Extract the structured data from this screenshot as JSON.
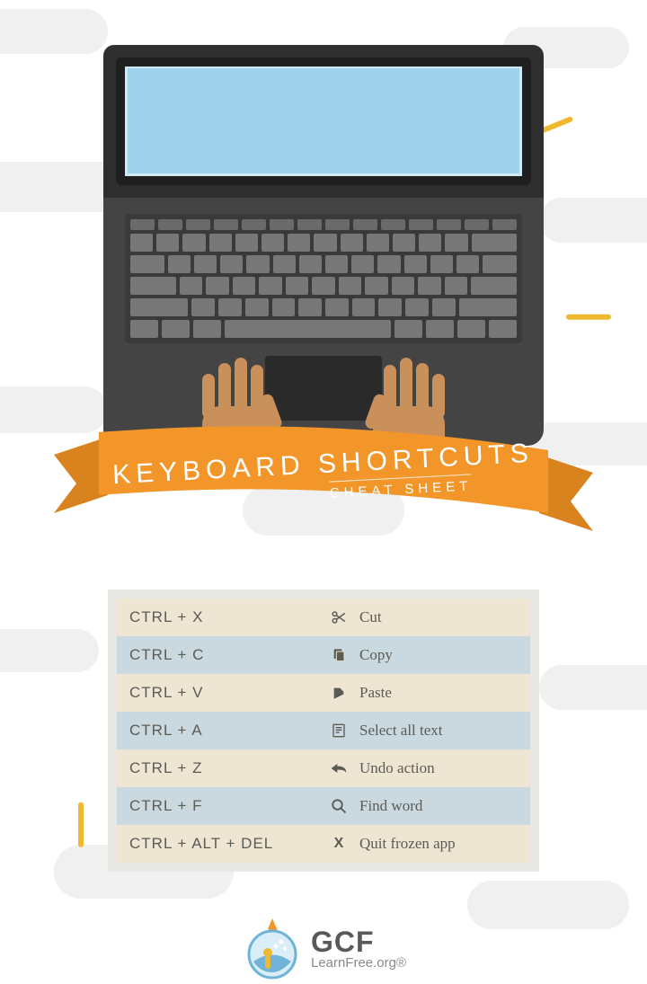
{
  "header": {
    "title": "KEYBOARD SHORTCUTS",
    "subtitle": "CHEAT SHEET"
  },
  "shortcuts": [
    {
      "keys": "CTRL + X",
      "icon": "scissors-icon",
      "label": "Cut"
    },
    {
      "keys": "CTRL + C",
      "icon": "copy-icon",
      "label": "Copy"
    },
    {
      "keys": "CTRL + V",
      "icon": "paste-icon",
      "label": "Paste"
    },
    {
      "keys": "CTRL + A",
      "icon": "select-all-icon",
      "label": "Select all text"
    },
    {
      "keys": "CTRL + Z",
      "icon": "undo-icon",
      "label": "Undo action"
    },
    {
      "keys": "CTRL + F",
      "icon": "find-icon",
      "label": "Find word"
    },
    {
      "keys": "CTRL + ALT + DEL",
      "icon": "quit-icon",
      "label": "Quit frozen app"
    }
  ],
  "logo": {
    "primary": "GCF",
    "secondary": "LearnFree.org®"
  },
  "colors": {
    "ribbon": "#f2962a",
    "ray": "#f0b82e",
    "row_odd": "#efe5d3",
    "row_even": "#cad9df"
  }
}
